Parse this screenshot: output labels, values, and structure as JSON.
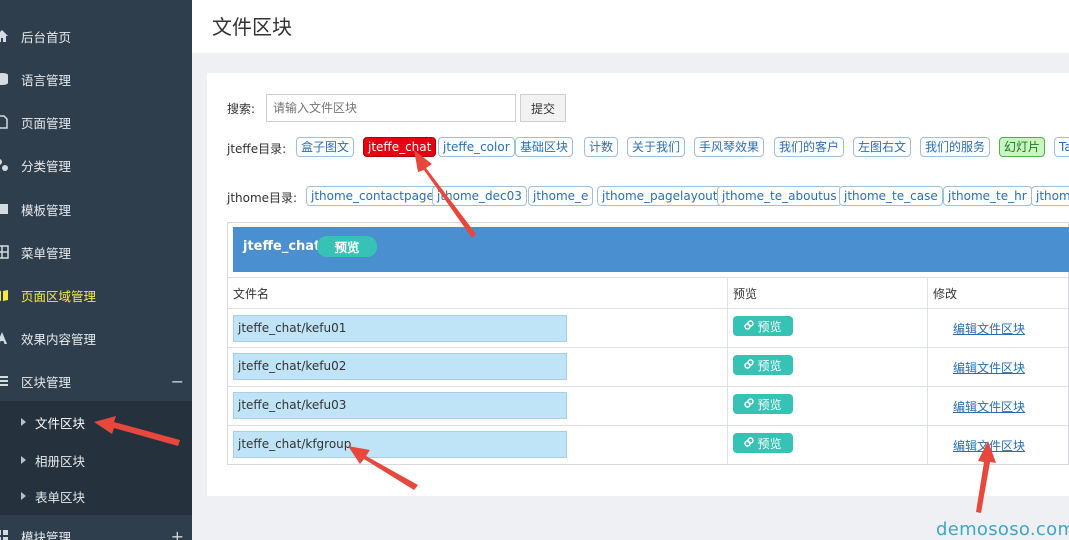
{
  "sidebar": {
    "items": [
      {
        "label": "后台首页",
        "icon": "home-icon"
      },
      {
        "label": "语言管理",
        "icon": "database-icon"
      },
      {
        "label": "页面管理",
        "icon": "file-icon"
      },
      {
        "label": "分类管理",
        "icon": "sitemap-icon"
      },
      {
        "label": "模板管理",
        "icon": "template-icon"
      },
      {
        "label": "菜单管理",
        "icon": "grid-icon"
      },
      {
        "label": "页面区域管理",
        "icon": "book-icon"
      },
      {
        "label": "效果内容管理",
        "icon": "font-icon"
      },
      {
        "label": "区块管理",
        "icon": "list-icon",
        "toggle": "−"
      }
    ],
    "submenu": [
      {
        "label": "文件区块"
      },
      {
        "label": "相册区块"
      },
      {
        "label": "表单区块"
      }
    ],
    "bottom_item": {
      "label": "模块管理",
      "toggle": "+"
    }
  },
  "header": {
    "title": "文件区块"
  },
  "search": {
    "label": "搜索:",
    "placeholder": "请输入文件区块",
    "button_label": "提交"
  },
  "jteffe": {
    "label": "jteffe目录:",
    "tags": [
      "盒子图文",
      "jteffe_chat",
      "jteffe_color",
      "基础区块",
      "计数",
      "关于我们",
      "手风琴效果",
      "我们的客户",
      "左图右文",
      "我们的服务",
      "幻灯片",
      "Ta"
    ]
  },
  "jthome": {
    "label": "jthome目录:",
    "tags": [
      "jthome_contactpage",
      "jthome_dec03",
      "jthome_e",
      "jthome_pagelayout",
      "jthome_te_aboutus",
      "jthome_te_case",
      "jthome_te_hr",
      "jthome"
    ]
  },
  "table": {
    "title": "jteffe_chat",
    "preview_label": "预览",
    "columns": [
      "文件名",
      "预览",
      "修改"
    ],
    "rows": [
      {
        "filename": "jteffe_chat/kefu01",
        "preview": "预览",
        "edit": "编辑文件区块"
      },
      {
        "filename": "jteffe_chat/kefu02",
        "preview": "预览",
        "edit": "编辑文件区块"
      },
      {
        "filename": "jteffe_chat/kefu03",
        "preview": "预览",
        "edit": "编辑文件区块"
      },
      {
        "filename": "jteffe_chat/kfgroup",
        "preview": "预览",
        "edit": "编辑文件区块"
      }
    ]
  },
  "watermark": "demososo.com",
  "colors": {
    "sidebar_bg": "#2f3e4c",
    "active_nav": "#f5e94a",
    "header_blue": "#4a8fd0",
    "teal_button": "#37c2b6",
    "active_tag": "#e60012",
    "annotation_arrow": "#e8473c"
  }
}
